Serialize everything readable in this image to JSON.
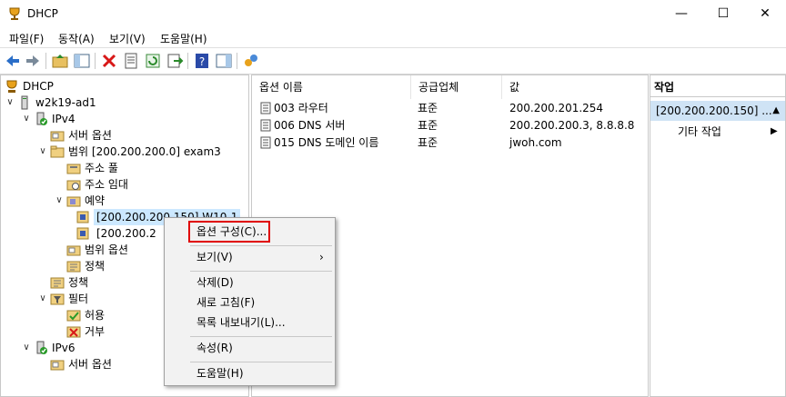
{
  "window": {
    "title": "DHCP",
    "minimize": "—",
    "maximize": "☐",
    "close": "✕"
  },
  "menu": [
    "파일(F)",
    "동작(A)",
    "보기(V)",
    "도움말(H)"
  ],
  "tree": {
    "root": "DHCP",
    "server": "w2k19-ad1",
    "ipv4": "IPv4",
    "server_options": "서버 옵션",
    "scope": "범위 [200.200.200.0] exam3",
    "address_pool": "주소 풀",
    "address_leases": "주소 임대",
    "reservations": "예약",
    "res1": "[200.200.200.150] W10-1",
    "res2": "[200.200.2",
    "scope_options": "범위 옵션",
    "scope_policies": "정책",
    "policies": "정책",
    "filters": "필터",
    "allow": "허용",
    "deny": "거부",
    "ipv6": "IPv6",
    "ipv6_server_options": "서버 옵션"
  },
  "list": {
    "columns": [
      "옵션 이름",
      "공급업체",
      "값"
    ],
    "rows": [
      {
        "name": "003 라우터",
        "vendor": "표준",
        "value": "200.200.201.254"
      },
      {
        "name": "006 DNS 서버",
        "vendor": "표준",
        "value": "200.200.200.3, 8.8.8.8"
      },
      {
        "name": "015 DNS 도메인 이름",
        "vendor": "표준",
        "value": "jwoh.com"
      }
    ]
  },
  "actions": {
    "header": "작업",
    "selected": "[200.200.200.150] ...",
    "more": "기타 작업"
  },
  "context_menu": {
    "configure_options": "옵션 구성(C)...",
    "view": "보기(V)",
    "delete": "삭제(D)",
    "refresh": "새로 고침(F)",
    "export": "목록 내보내기(L)...",
    "properties": "속성(R)",
    "help": "도움말(H)"
  },
  "colors": {
    "selection": "#cce8ff",
    "highlight_box": "#e00000",
    "action_selected": "#cfe3f5"
  }
}
